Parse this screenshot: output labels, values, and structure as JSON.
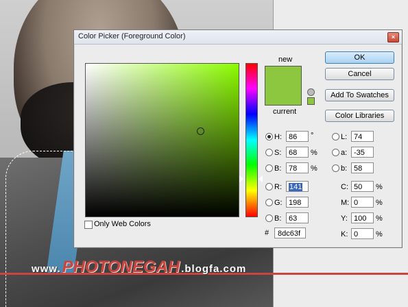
{
  "dialog": {
    "title": "Color Picker (Foreground Color)",
    "close_glyph": "×"
  },
  "preview": {
    "new_label": "new",
    "current_label": "current",
    "new_color": "#8dc63f",
    "current_color": "#8dc63f"
  },
  "buttons": {
    "ok": "OK",
    "cancel": "Cancel",
    "add_to_swatches": "Add To Swatches",
    "color_libraries": "Color Libraries"
  },
  "hsb": {
    "h_label": "H:",
    "h_value": "86",
    "h_unit": "°",
    "s_label": "S:",
    "s_value": "68",
    "s_unit": "%",
    "b_label": "B:",
    "b_value": "78",
    "b_unit": "%"
  },
  "rgb": {
    "r_label": "R:",
    "r_value": "141",
    "g_label": "G:",
    "g_value": "198",
    "b_label": "B:",
    "b_value": "63"
  },
  "lab": {
    "l_label": "L:",
    "l_value": "74",
    "a_label": "a:",
    "a_value": "-35",
    "b_label": "b:",
    "b_value": "58"
  },
  "cmyk": {
    "c_label": "C:",
    "c_value": "50",
    "c_unit": "%",
    "m_label": "M:",
    "m_value": "0",
    "m_unit": "%",
    "y_label": "Y:",
    "y_value": "100",
    "y_unit": "%",
    "k_label": "K:",
    "k_value": "0",
    "k_unit": "%"
  },
  "hex": {
    "hash": "#",
    "value": "8dc63f"
  },
  "websafe": {
    "label": "Only Web Colors",
    "checked": false
  },
  "selected_radio": "H",
  "watermark": {
    "prefix": "www.",
    "brand": "PHOTONEGAH",
    "suffix": ".blogfa.com"
  },
  "colors": {
    "accent": "#8dc63f",
    "brand_red": "#c8463f",
    "ok_blue": "#a9d2f2"
  }
}
